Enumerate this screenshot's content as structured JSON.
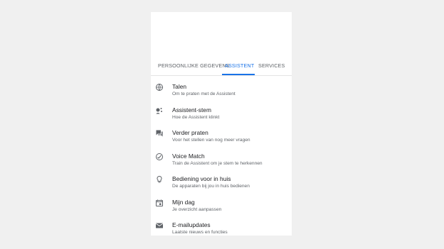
{
  "tabs": [
    {
      "label": "PERSOONLIJKE GEGEVENS",
      "active": false
    },
    {
      "label": "ASSISTENT",
      "active": true
    },
    {
      "label": "SERVICES",
      "active": false
    }
  ],
  "items": [
    {
      "title": "Talen",
      "subtitle": "Om te praten met de Assistent",
      "icon": "globe-icon"
    },
    {
      "title": "Assistent-stem",
      "subtitle": "Hoe de Assistent klinkt",
      "icon": "assistant-voice-icon"
    },
    {
      "title": "Verder praten",
      "subtitle": "Voor het stellen van nog meer vragen",
      "icon": "chat-bubbles-icon"
    },
    {
      "title": "Voice Match",
      "subtitle": "Train de Assistent om je stem te herkennen",
      "icon": "voice-match-icon"
    },
    {
      "title": "Bediening voor in huis",
      "subtitle": "De apparaten bij jou in huis bedienen",
      "icon": "lightbulb-icon"
    },
    {
      "title": "Mijn dag",
      "subtitle": "Je overzicht aanpassen",
      "icon": "calendar-icon"
    },
    {
      "title": "E-mailupdates",
      "subtitle": "Laatste nieuws en functies",
      "icon": "mail-icon"
    }
  ],
  "colors": {
    "accent": "#1a73e8",
    "text": "#202124",
    "secondary": "#5f6368"
  }
}
